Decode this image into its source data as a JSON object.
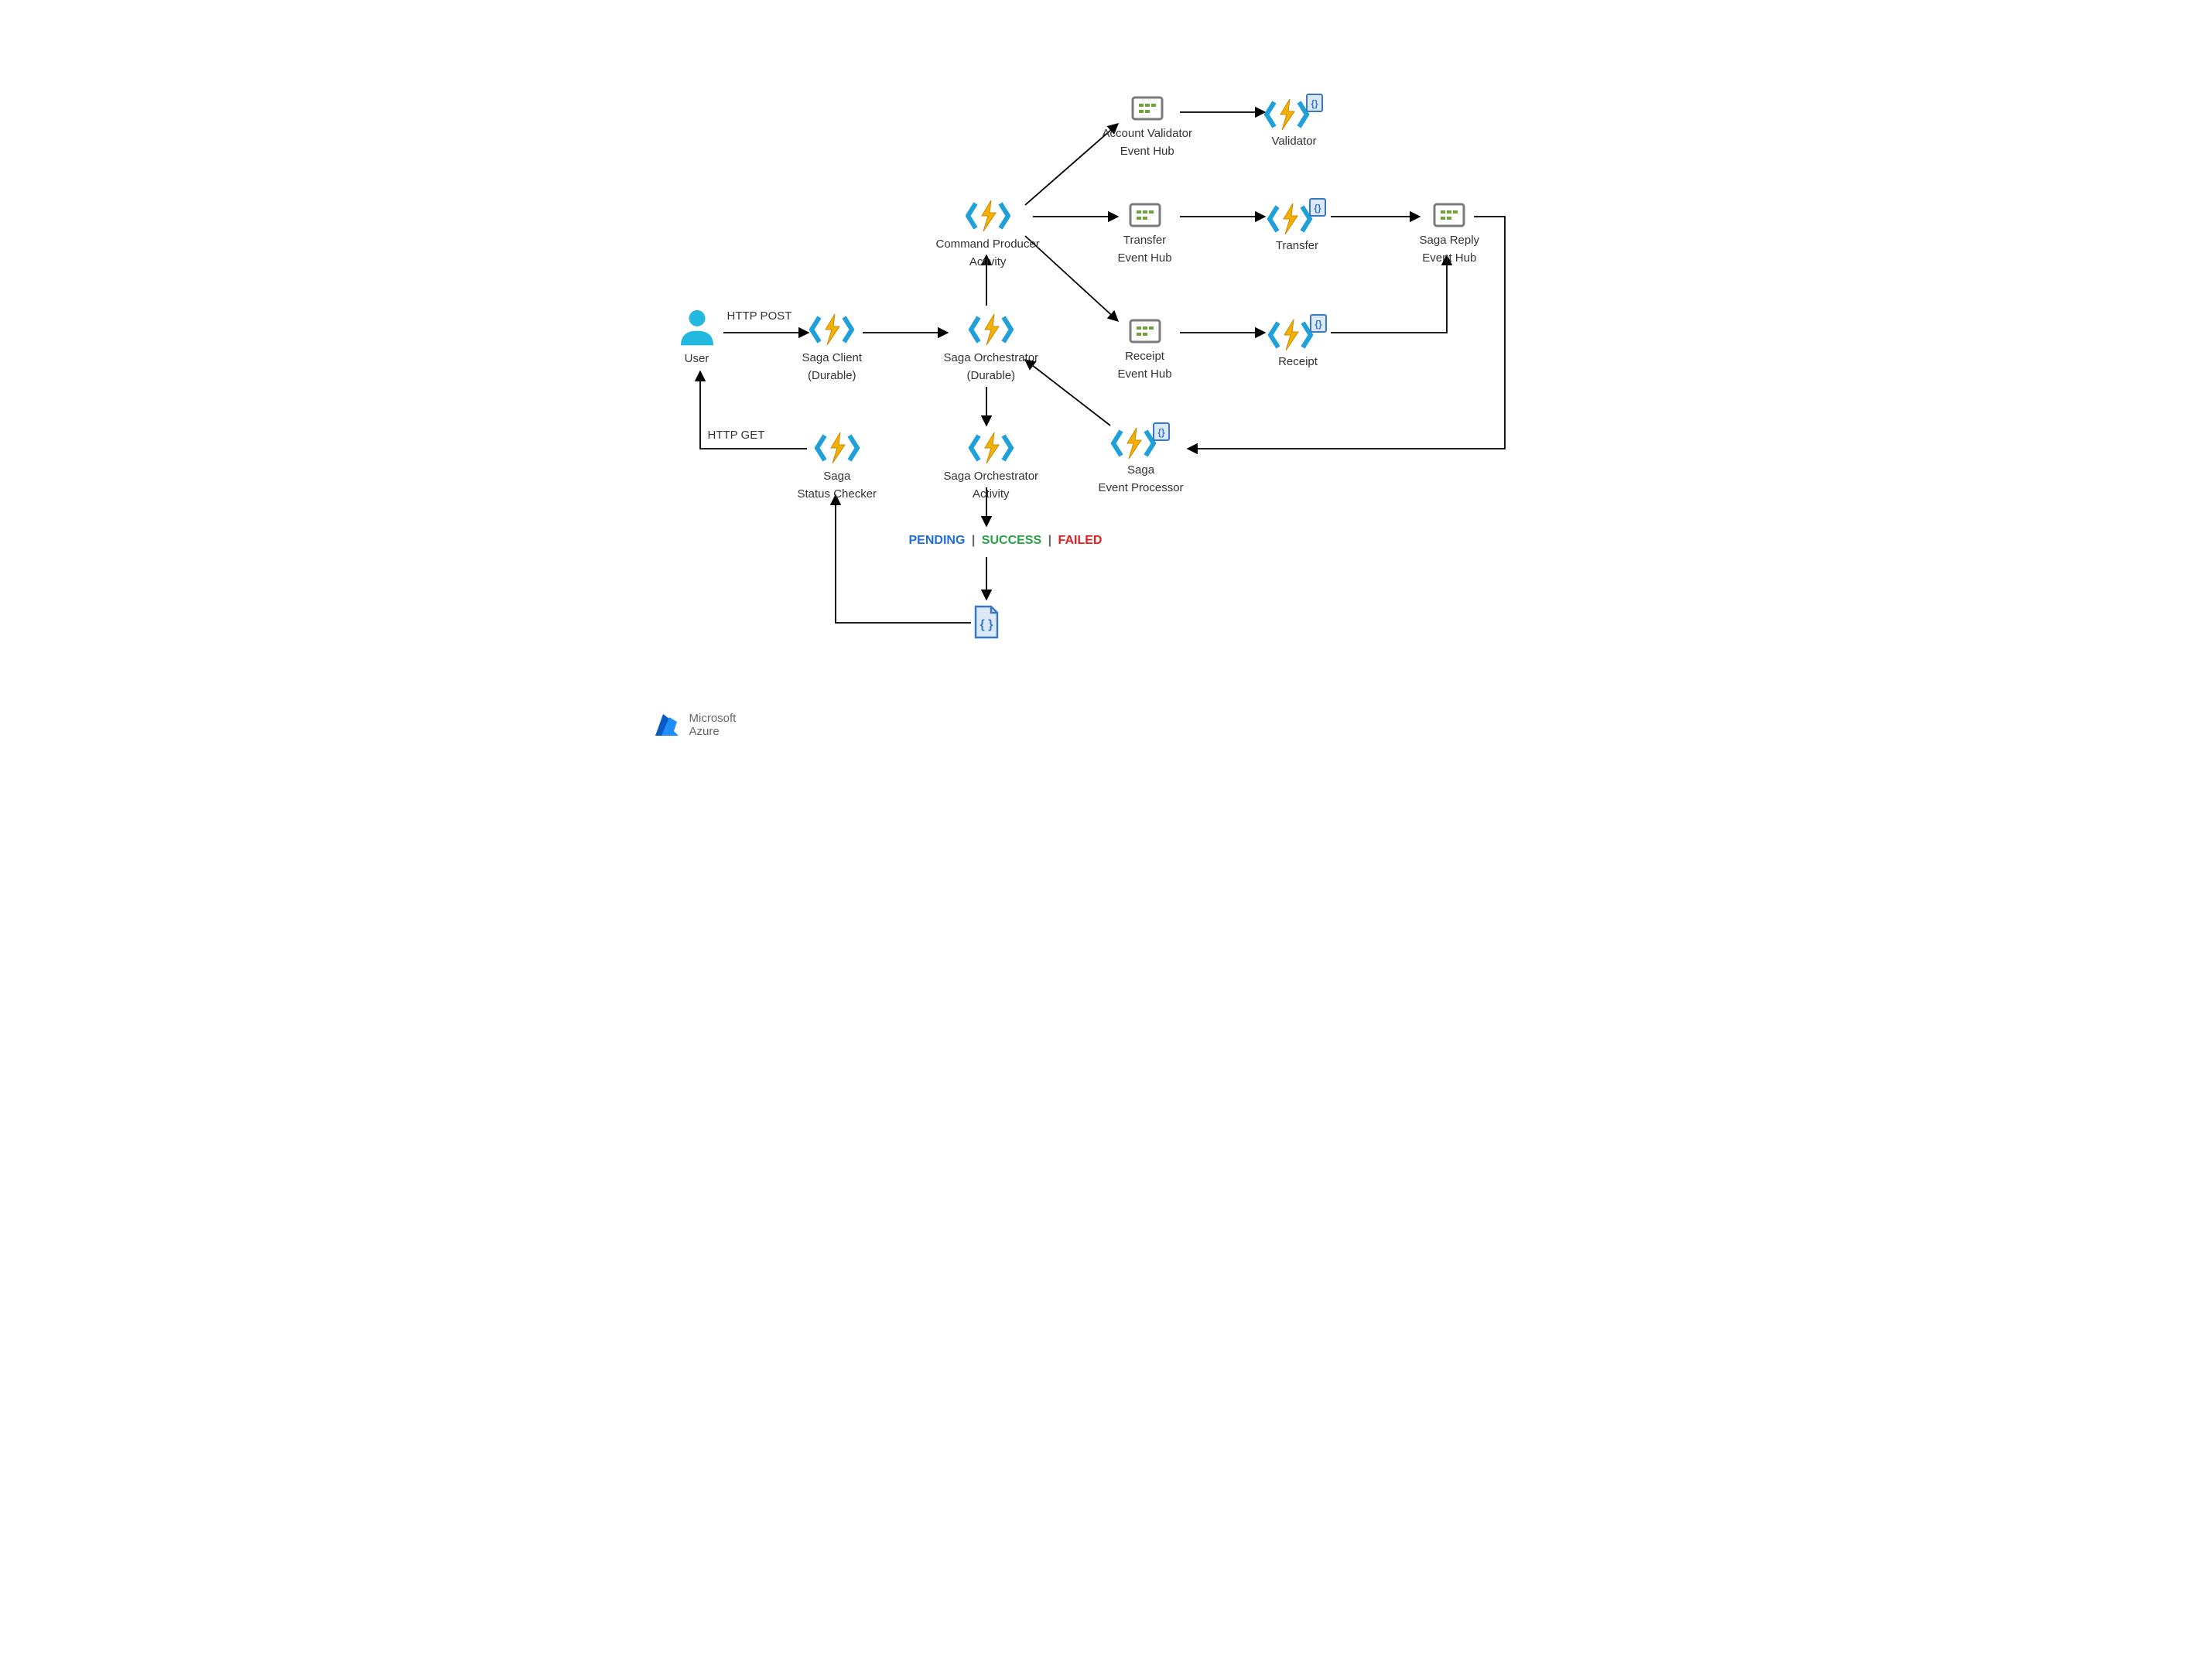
{
  "nodes": {
    "user": {
      "label": "User"
    },
    "saga_client": {
      "label_l1": "Saga Client",
      "label_l2": "(Durable)"
    },
    "saga_orchestrator": {
      "label_l1": "Saga Orchestrator",
      "label_l2": "(Durable)"
    },
    "command_producer": {
      "label_l1": "Command Producer",
      "label_l2": "Activity"
    },
    "account_validator_eh": {
      "label_l1": "Account Validator",
      "label_l2": "Event Hub"
    },
    "transfer_eh": {
      "label_l1": "Transfer",
      "label_l2": "Event Hub"
    },
    "receipt_eh": {
      "label_l1": "Receipt",
      "label_l2": "Event Hub"
    },
    "validator": {
      "label": "Validator"
    },
    "transfer": {
      "label": "Transfer"
    },
    "receipt": {
      "label": "Receipt"
    },
    "saga_reply_eh": {
      "label_l1": "Saga Reply",
      "label_l2": "Event Hub"
    },
    "saga_event_processor": {
      "label_l1": "Saga",
      "label_l2": "Event Processor"
    },
    "saga_orchestrator_activity": {
      "label_l1": "Saga Orchestrator",
      "label_l2": "Activity"
    },
    "saga_status_checker": {
      "label_l1": "Saga",
      "label_l2": "Status Checker"
    },
    "cosmos": {
      "label": ""
    }
  },
  "edges": {
    "http_post": "HTTP POST",
    "http_get": "HTTP GET"
  },
  "status": {
    "pending": "PENDING",
    "success": "SUCCESS",
    "failed": "FAILED"
  },
  "logo": {
    "line1": "Microsoft",
    "line2": "Azure"
  }
}
